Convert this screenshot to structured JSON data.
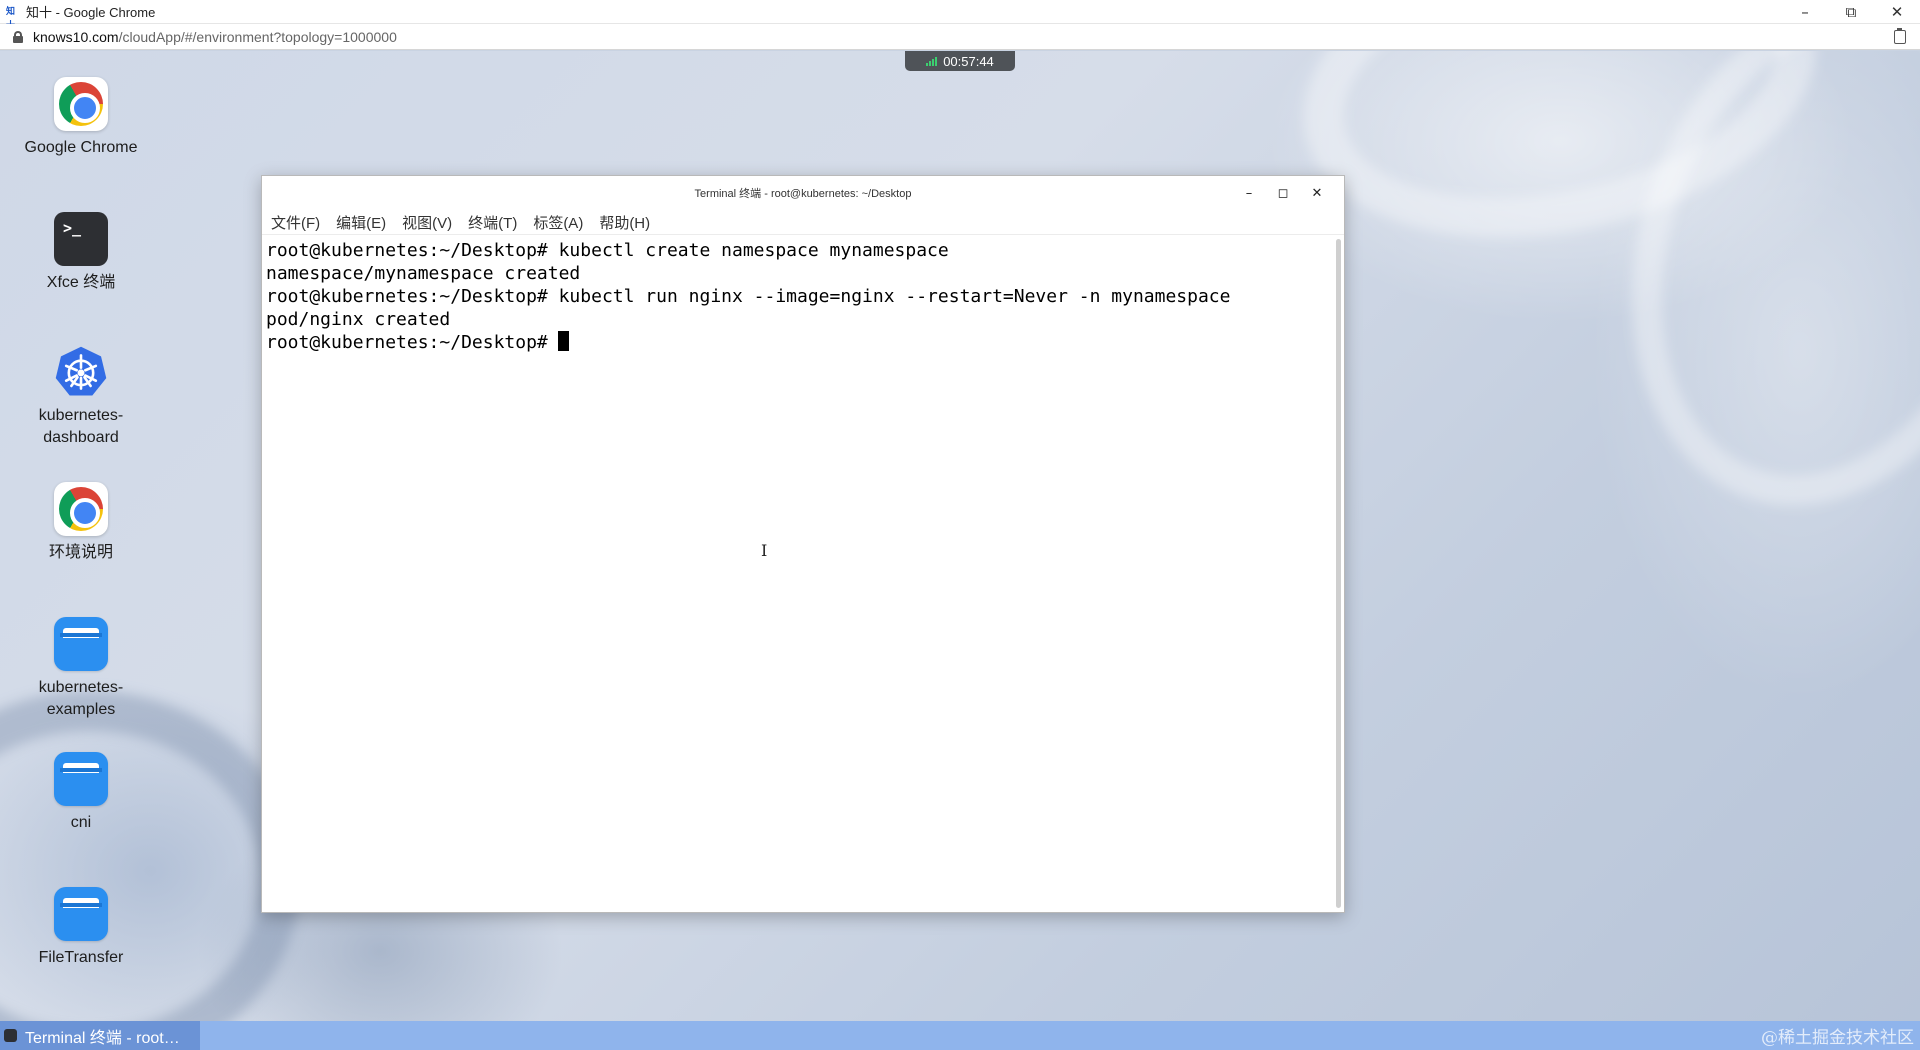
{
  "browser": {
    "favicon_text": "知十",
    "window_title": "知十 - Google Chrome",
    "url_host": "knows10.com",
    "url_path": "/cloudApp/#/environment?topology=1000000",
    "minimize": "–",
    "restore": "⧉",
    "close": "✕"
  },
  "session": {
    "timer": "00:57:44"
  },
  "desktop_icons": [
    {
      "label": "Google Chrome",
      "icon": "chrome-icon"
    },
    {
      "label": "Xfce 终端",
      "icon": "terminal-icon"
    },
    {
      "label": "kubernetes-dashboard",
      "icon": "kubernetes-icon"
    },
    {
      "label": "环境说明",
      "icon": "chrome-icon"
    },
    {
      "label": "kubernetes-examples",
      "icon": "folder-icon"
    },
    {
      "label": "cni",
      "icon": "folder-icon"
    },
    {
      "label": "FileTransfer",
      "icon": "folder-icon"
    }
  ],
  "terminal": {
    "title": "Terminal 终端 - root@kubernetes: ~/Desktop",
    "menu": [
      "文件(F)",
      "编辑(E)",
      "视图(V)",
      "终端(T)",
      "标签(A)",
      "帮助(H)"
    ],
    "prompt_symbol": ">_",
    "lines": [
      "root@kubernetes:~/Desktop# kubectl create namespace mynamespace",
      "namespace/mynamespace created",
      "root@kubernetes:~/Desktop# kubectl run nginx --image=nginx --restart=Never -n mynamespace",
      "pod/nginx created",
      "root@kubernetes:~/Desktop#"
    ],
    "controls": {
      "minimize": "–",
      "maximize": "◻",
      "close": "✕"
    }
  },
  "taskbar": {
    "item_label": "Terminal 终端 - root…",
    "watermark": "@稀土掘金技术社区"
  },
  "colors": {
    "taskbar": "#8fb4ec",
    "taskbar_active": "#6b93d6",
    "folder": "#2b8ff0",
    "kubernetes": "#326ce5",
    "signal": "#3cd070"
  }
}
